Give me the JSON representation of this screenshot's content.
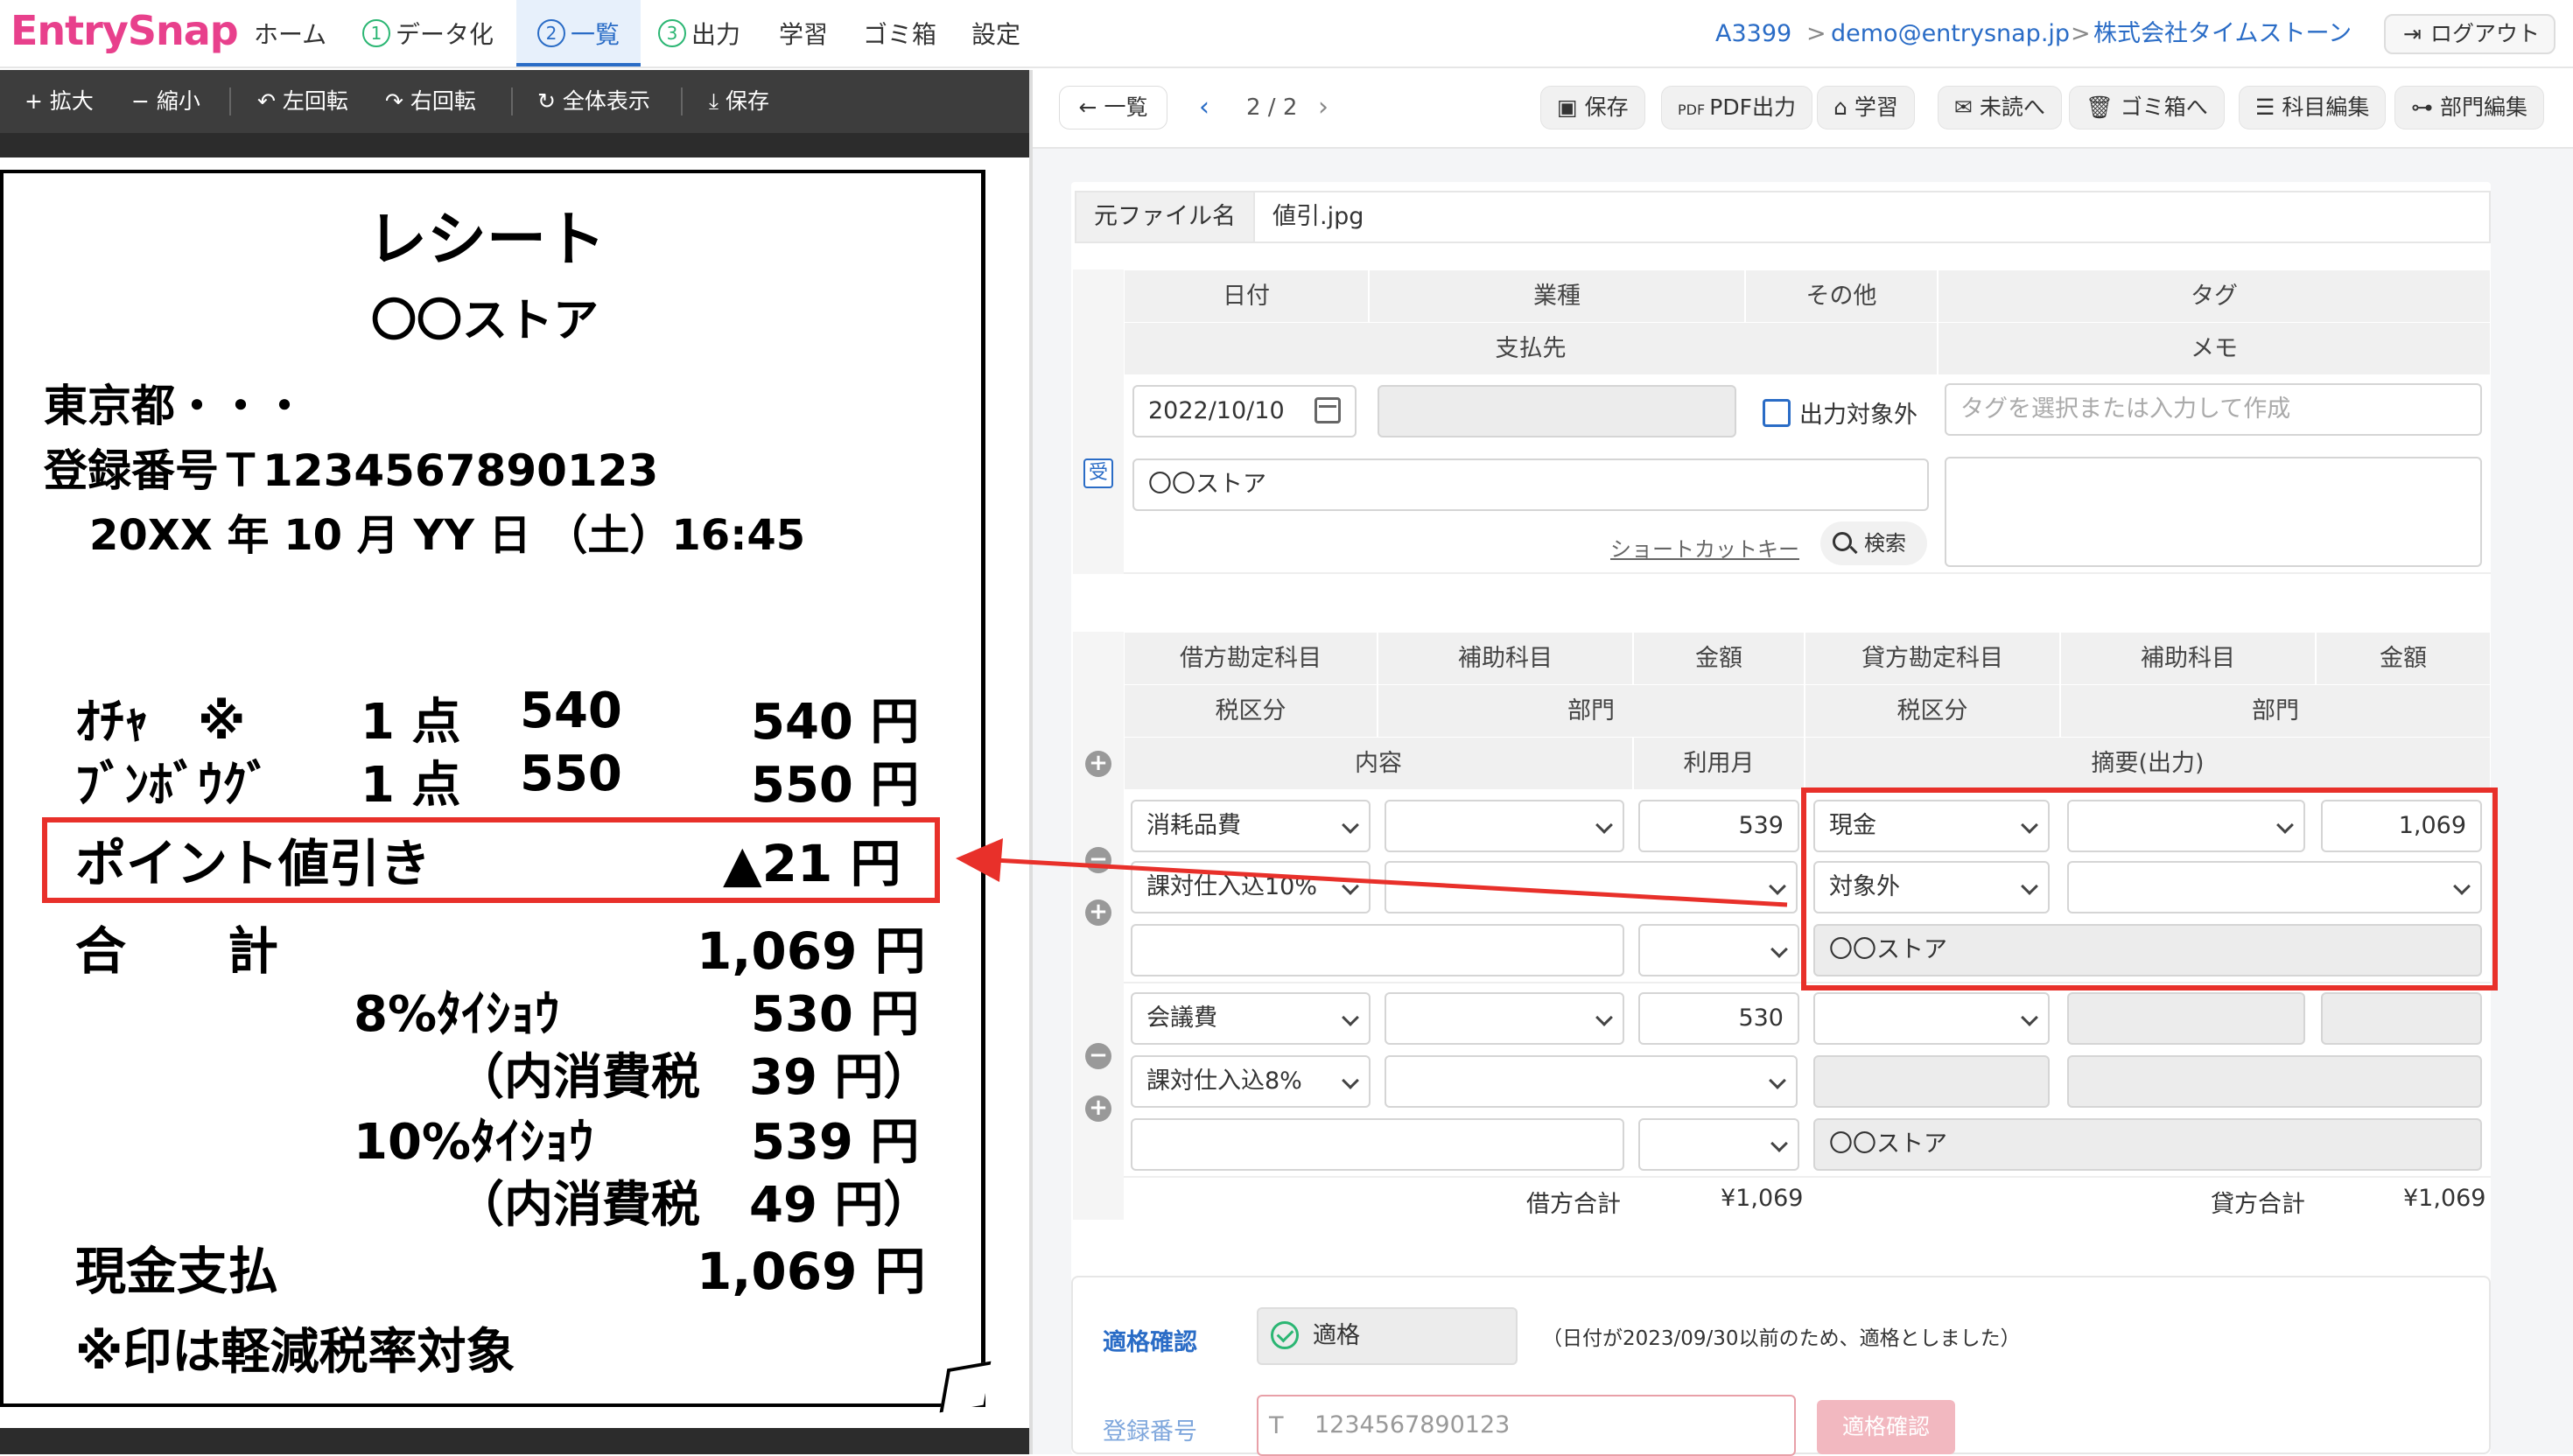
{
  "app": {
    "logo": "EntrySnap"
  },
  "nav": {
    "home": "ホーム",
    "data": "データ化",
    "list": "一覧",
    "output": "出力",
    "learn": "学習",
    "trash": "ゴミ箱",
    "settings": "設定",
    "num1": "1",
    "num2": "2",
    "num3": "3"
  },
  "breadcrumb": {
    "account": "A3399",
    "email": "demo@entrysnap.jp",
    "company": "株式会社タイムストーン",
    "sep": ">"
  },
  "logout": "ログアウト",
  "viewer_toolbar": {
    "zoom_in": "+ 拡大",
    "zoom_out": "− 縮小",
    "rotate_left": "左回転",
    "rotate_right": "右回転",
    "fit": "全体表示",
    "save": "保存"
  },
  "receipt": {
    "title": "レシート",
    "store": "〇〇ストア",
    "address": "東京都・・・",
    "reg": "登録番号Ｔ1234567890123",
    "datetime": "20XX 年 10 月 YY 日 （土）16:45",
    "item1_name": "ｵﾁｬ　※",
    "item1_qty": "1 点",
    "item1_price": "540",
    "item1_total": "540 円",
    "item2_name": "ﾌﾞﾝﾎﾞｳｸﾞ",
    "item2_qty": "1 点",
    "item2_price": "550",
    "item2_total": "550 円",
    "discount_label": "ポイント値引き",
    "discount_value": "▲21 円",
    "total_label": "合　　計",
    "total_value": "1,069 円",
    "tax8_label": "8%ﾀｲｼｮｳ",
    "tax8_value": "530 円",
    "tax8_inner": "（内消費税　39 円）",
    "tax10_label": "10%ﾀｲｼｮｳ",
    "tax10_value": "539 円",
    "tax10_inner": "（内消費税　49 円）",
    "cash_label": "現金支払",
    "cash_value": "1,069 円",
    "footnote": "※印は軽減税率対象"
  },
  "right_toolbar": {
    "back": "一覧",
    "page": "2 / 2",
    "save": "保存",
    "pdf": "PDF出力",
    "learn": "学習",
    "unread": "未読へ",
    "trash": "ゴミ箱へ",
    "account_edit": "科目編集",
    "dept_edit": "部門編集"
  },
  "file": {
    "label": "元ファイル名",
    "value": "値引.jpg"
  },
  "header_form": {
    "date": "日付",
    "industry": "業種",
    "other": "その他",
    "tag": "タグ",
    "payee": "支払先",
    "memo": "メモ",
    "date_value": "2022/10/10",
    "exclude_label": "出力対象外",
    "tag_placeholder": "タグを選択または入力して作成",
    "payee_value": "〇〇ストア",
    "shortcut": "ショートカットキー",
    "search": "検索",
    "receipt_icon": "受"
  },
  "journal_headers": {
    "debit_account": "借方勘定科目",
    "debit_sub": "補助科目",
    "debit_amount": "金額",
    "credit_account": "貸方勘定科目",
    "credit_sub": "補助科目",
    "credit_amount": "金額",
    "debit_tax": "税区分",
    "debit_dept": "部門",
    "credit_tax": "税区分",
    "credit_dept": "部門",
    "content": "内容",
    "month": "利用月",
    "summary": "摘要(出力)"
  },
  "row1": {
    "debit_account": "消耗品費",
    "debit_amount": "539",
    "debit_tax": "課対仕入込10%",
    "credit_account": "現金",
    "credit_amount": "1,069",
    "credit_tax": "対象外",
    "summary": "〇〇ストア"
  },
  "row2": {
    "debit_account": "会議費",
    "debit_amount": "530",
    "debit_tax": "課対仕入込8%",
    "summary": "〇〇ストア"
  },
  "totals": {
    "debit_label": "借方合計",
    "debit_value": "¥1,069",
    "credit_label": "貸方合計",
    "credit_value": "¥1,069"
  },
  "compliance": {
    "label": "適格確認",
    "status": "適格",
    "note": "（日付が2023/09/30以前のため、適格としました）",
    "reg_label": "登録番号",
    "reg_prefix": "T",
    "reg_placeholder": "1234567890123",
    "reg_button": "適格確認"
  },
  "colors": {
    "accent": "#2a6cc6",
    "brand": "#e8408c",
    "annotation": "#e8302a"
  }
}
